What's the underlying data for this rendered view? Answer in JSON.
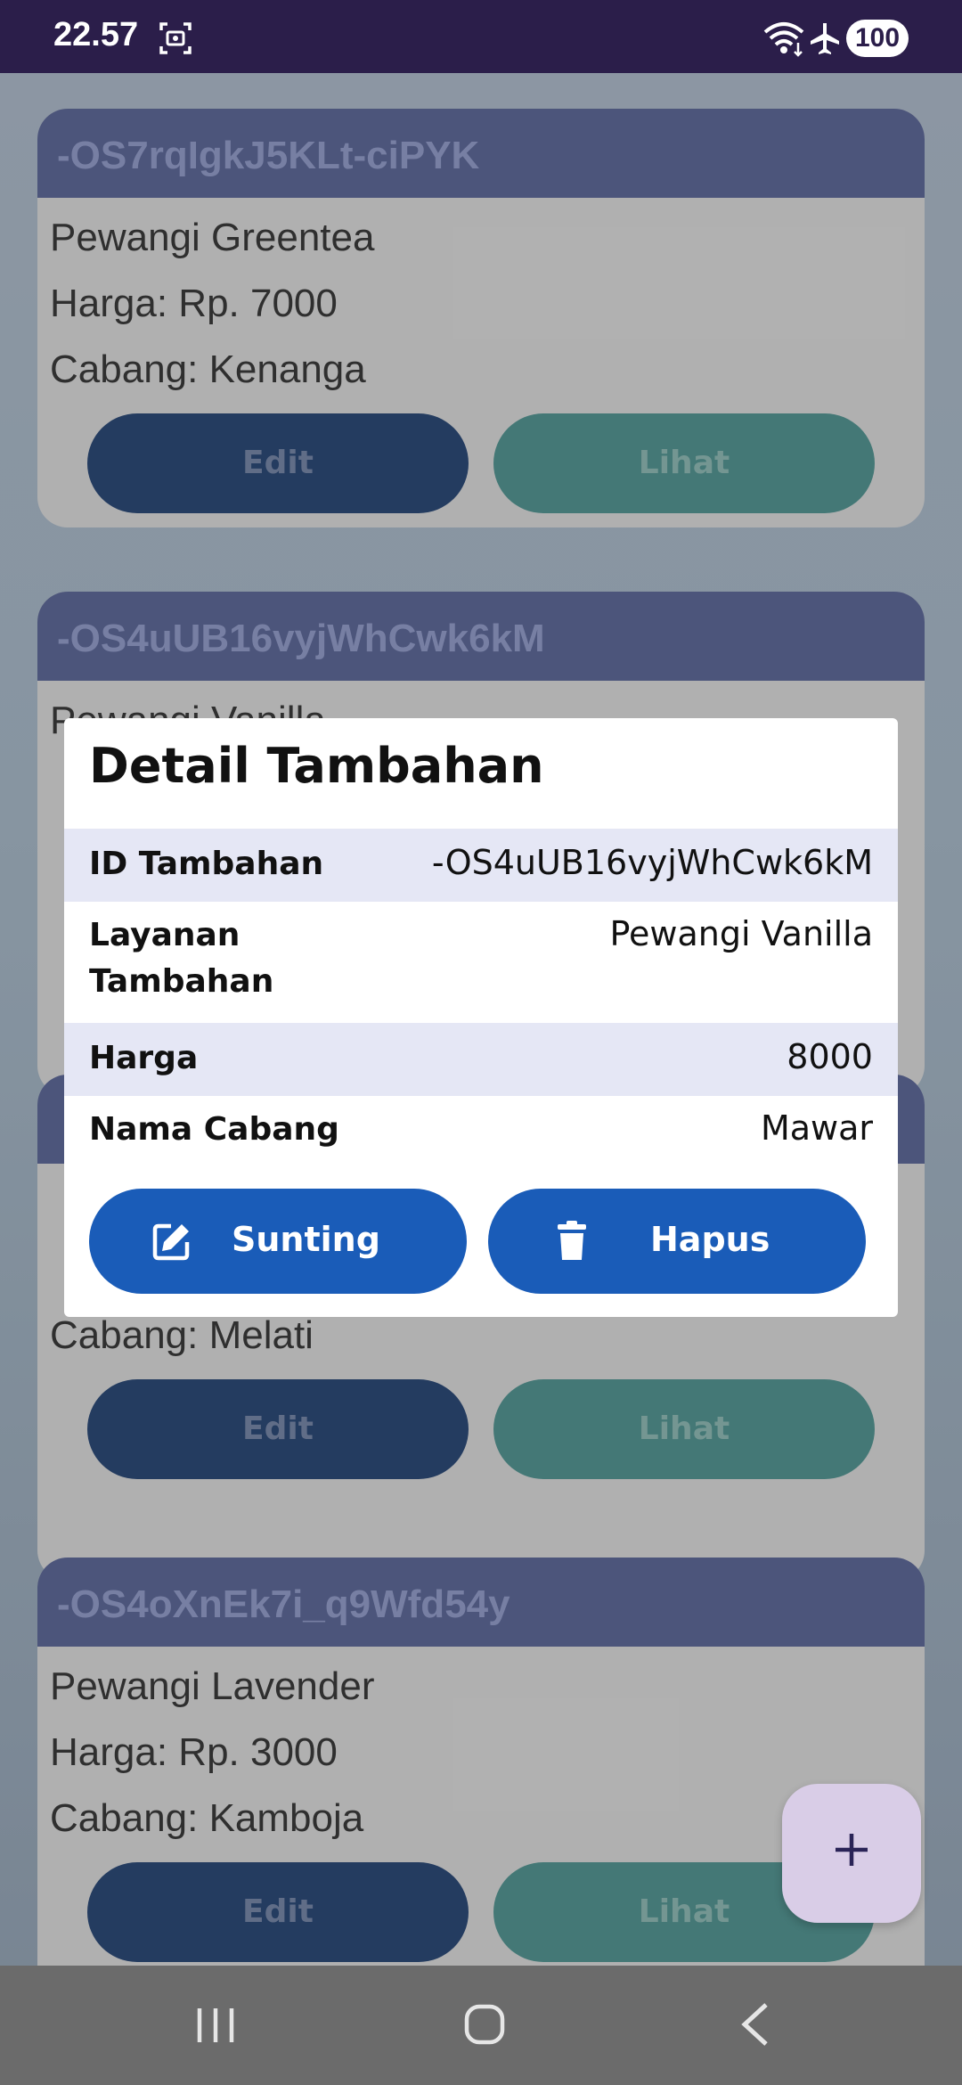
{
  "status_bar": {
    "time": "22.57",
    "battery": "100"
  },
  "cards": [
    {
      "id": "-OS7rqIgkJ5KLt-ciPYK",
      "name": "Pewangi Greentea",
      "price": "Harga: Rp. 7000",
      "branch": "Cabang: Kenanga",
      "edit_label": "Edit",
      "view_label": "Lihat"
    },
    {
      "id": "-OS4uUB16vyjWhCwk6kM",
      "name": "Pewangi Vanilla",
      "price": "",
      "branch": "",
      "edit_label": "",
      "view_label": ""
    },
    {
      "id": "",
      "name": "",
      "price": "",
      "branch": "Cabang: Melati",
      "edit_label": "Edit",
      "view_label": "Lihat"
    },
    {
      "id": "-OS4oXnEk7i_q9Wfd54y",
      "name": "Pewangi Lavender",
      "price": "Harga: Rp. 3000",
      "branch": "Cabang: Kamboja",
      "edit_label": "Edit",
      "view_label": "Lihat"
    }
  ],
  "dialog": {
    "title": "Detail Tambahan",
    "rows": [
      {
        "label": "ID Tambahan",
        "value": "-OS4uUB16vyjWhCwk6kM"
      },
      {
        "label": "Layanan\nTambahan",
        "value": "Pewangi Vanilla"
      },
      {
        "label": "Harga",
        "value": "8000"
      },
      {
        "label": "Nama Cabang",
        "value": "Mawar"
      }
    ],
    "edit_button": "Sunting",
    "delete_button": "Hapus"
  },
  "colors": {
    "header_bg": "#4a5893",
    "edit_btn": "#0c3169",
    "view_btn": "#3d8f8b",
    "dialog_btn": "#1a5cb8",
    "row_alt": "#e5e7f5",
    "status_bar": "#2b1e4a"
  },
  "icons": {
    "fab": "plus-icon",
    "edit": "edit-icon",
    "delete": "trash-icon"
  }
}
